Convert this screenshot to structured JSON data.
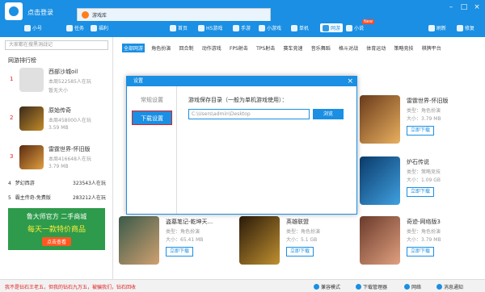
{
  "titlebar": {
    "app_title": "点击登录",
    "tab_label": "游戏库",
    "window_controls": [
      "–",
      "□",
      "×"
    ]
  },
  "topnav": {
    "items": [
      {
        "label": "小号"
      },
      {
        "label": "任务"
      },
      {
        "label": "福利"
      },
      {
        "label": "首页"
      },
      {
        "label": "H5游戏"
      },
      {
        "label": "手游"
      },
      {
        "label": "小游戏"
      },
      {
        "label": "单机"
      },
      {
        "label": "网游"
      },
      {
        "label": "小说"
      }
    ],
    "active": "网游",
    "new_badge": "New",
    "right": [
      {
        "label": "刷新"
      },
      {
        "label": "修复"
      }
    ]
  },
  "sidebar": {
    "search_placeholder": "大家都在搜黑洞战记",
    "rank_title": "网游排行榜",
    "ranks": [
      {
        "num": "1",
        "name": "西部沙城oil",
        "meta": "本周522585人在玩",
        "meta2": "暂无大小"
      },
      {
        "num": "2",
        "name": "原始传奇",
        "meta": "本周458000人在玩",
        "meta2": "3.59 MB"
      },
      {
        "num": "3",
        "name": "雷霆世界-怀旧版",
        "meta": "本周416648人在玩",
        "meta2": "3.79 MB"
      }
    ],
    "mini": [
      {
        "num": "4",
        "name": "梦幻西游",
        "count": "323543人在玩"
      },
      {
        "num": "5",
        "name": "霸主传奇-免费版",
        "count": "283212人在玩"
      }
    ],
    "ad": {
      "line1": "鲁大师官方 二手商城",
      "line2": "每天一款特价商品",
      "button": "点击查看"
    }
  },
  "main": {
    "categories": [
      "全部网游",
      "角色扮演",
      "回合制",
      "动作游戏",
      "FPS射击",
      "TPS射击",
      "赛车竞速",
      "音乐舞蹈",
      "格斗对战",
      "体育运动",
      "策略竞技",
      "棋牌平台"
    ],
    "active_category": "全部网游",
    "cards": [
      {
        "name": "雷霆世界-怀旧版",
        "type": "类型：角色扮演",
        "size": "大小：3.79 MB",
        "button": "立即下载"
      },
      {
        "name": "炉石传说",
        "type": "类型：策略竞技",
        "size": "大小：1.09 GB",
        "button": "立即下载"
      },
      {
        "name": "盗墓笔记-乾坤天...",
        "type": "类型：角色扮演",
        "size": "大小：65.41 MB",
        "button": "立即下载"
      },
      {
        "name": "英雄联盟",
        "type": "类型：角色扮演",
        "size": "大小：5.1 GB",
        "button": "立即下载"
      },
      {
        "name": "奇迹-网络版3",
        "type": "类型：角色扮演",
        "size": "大小：3.79 MB",
        "button": "立即下载"
      }
    ]
  },
  "dialog": {
    "title": "设置",
    "tabs": [
      "常规设置",
      "下载设置"
    ],
    "active_tab": "下载设置",
    "label": "游戏保存目录（一般为单机游戏使用）：",
    "path_value": "C:\\Users\\admin\\Desktop",
    "browse": "浏览"
  },
  "status": {
    "ticker": "我不是钻石王老五，但我的钻石九万五，被骗我们，钻石回收",
    "items": [
      "兼容模式",
      "下载管理器",
      "网络",
      "消息通知"
    ]
  },
  "colors": {
    "accent": "#1a8fe3",
    "alert": "#e02020"
  }
}
